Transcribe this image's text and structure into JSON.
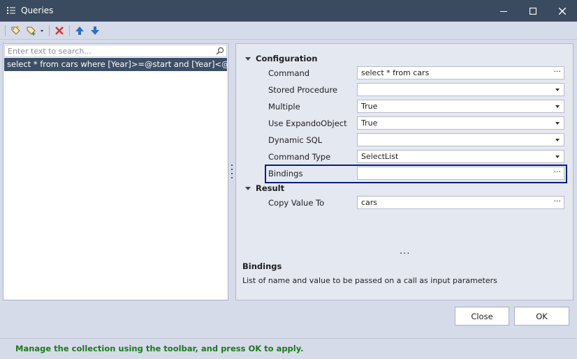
{
  "window": {
    "title": "Queries",
    "titlebar_color": "#3a4b60"
  },
  "toolbar": {
    "items": [
      {
        "icon": "add-query-icon"
      },
      {
        "icon": "add-dropdown-icon"
      },
      {
        "icon": "delete-icon"
      },
      {
        "icon": "move-up-icon"
      },
      {
        "icon": "move-down-icon"
      }
    ]
  },
  "left": {
    "search_placeholder": "Enter text to search...",
    "items": [
      {
        "label": "select * from cars where [Year]>=@start and [Year]<@end",
        "selected": true
      }
    ]
  },
  "properties": {
    "sections": [
      {
        "title": "Configuration",
        "rows": [
          {
            "label": "Command",
            "value": "select * from cars",
            "editor": "ellipsis"
          },
          {
            "label": "Stored Procedure",
            "value": "",
            "editor": "dropdown"
          },
          {
            "label": "Multiple",
            "value": "True",
            "editor": "dropdown"
          },
          {
            "label": "Use ExpandoObject",
            "value": "True",
            "editor": "dropdown"
          },
          {
            "label": "Dynamic SQL",
            "value": "",
            "editor": "dropdown"
          },
          {
            "label": "Command Type",
            "value": "SelectList",
            "editor": "dropdown"
          },
          {
            "label": "Bindings",
            "value": "",
            "editor": "ellipsis",
            "highlighted": true
          }
        ]
      },
      {
        "title": "Result",
        "rows": [
          {
            "label": "Copy Value To",
            "value": "cars",
            "editor": "ellipsis"
          }
        ]
      }
    ],
    "more_indicator": "...",
    "description": {
      "title": "Bindings",
      "text": "List of name and value to be passed on a call as input parameters"
    },
    "ellipsis_glyph": "···"
  },
  "buttons": {
    "close": "Close",
    "ok": "OK"
  },
  "status": {
    "message": "Manage the collection using the toolbar, and press OK to apply.",
    "color": "#1c7a1c"
  }
}
